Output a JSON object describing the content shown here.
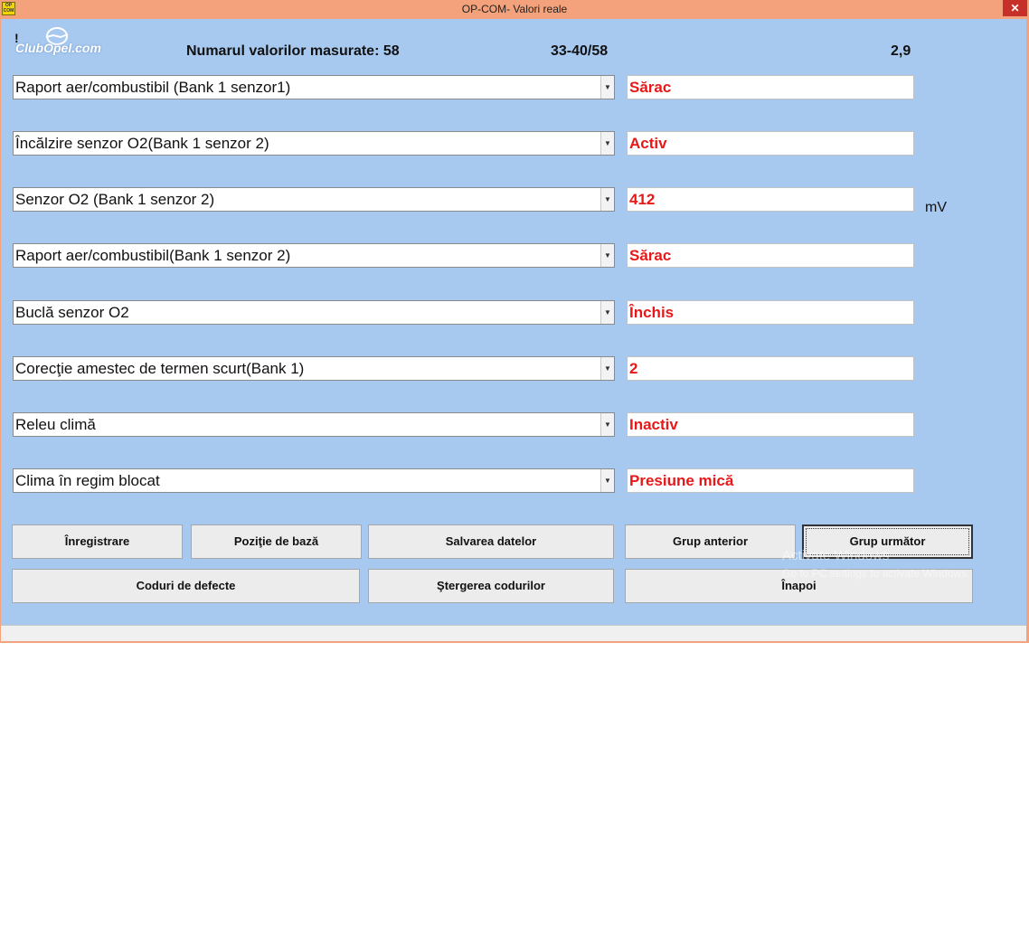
{
  "window": {
    "title": "OP-COM- Valori reale",
    "app_icon_text": "OP COM",
    "close_glyph": "✕",
    "accent_title": "#f4a27c",
    "background": "#a7c9f0"
  },
  "logo": {
    "text": "ClubOpel.com",
    "mark": "!"
  },
  "header": {
    "measured_label": "Numarul valorilor masurate: 58",
    "range": "33-40/58",
    "rate": "2,9"
  },
  "rows": [
    {
      "label": "Raport aer/combustibil (Bank 1 senzor1)",
      "value": "Sărac",
      "unit": ""
    },
    {
      "label": "Încălzire senzor O2(Bank 1 senzor 2)",
      "value": "Activ",
      "unit": ""
    },
    {
      "label": "Senzor O2 (Bank 1 senzor 2)",
      "value": "412",
      "unit": "mV"
    },
    {
      "label": "Raport aer/combustibil(Bank 1 senzor 2)",
      "value": "Sărac",
      "unit": ""
    },
    {
      "label": "Buclă senzor O2",
      "value": "Închis",
      "unit": ""
    },
    {
      "label": "Corecţie amestec de termen scurt(Bank 1)",
      "value": "2",
      "unit": ""
    },
    {
      "label": "Releu climă",
      "value": "Inactiv",
      "unit": ""
    },
    {
      "label": "Clima în regim blocat",
      "value": "Presiune mică",
      "unit": ""
    }
  ],
  "dropdown_arrow": "▼",
  "buttons": {
    "record": "Înregistrare",
    "base_position": "Poziţie de bază",
    "save_data": "Salvarea datelor",
    "prev_group": "Grup anterior",
    "next_group": "Grup următor",
    "fault_codes": "Coduri de defecte",
    "clear_codes": "Ştergerea codurilor",
    "back": "Înapoi"
  },
  "watermark": {
    "line1": "Activate Windows",
    "line2": "Go to PC settings to activate Windows."
  }
}
